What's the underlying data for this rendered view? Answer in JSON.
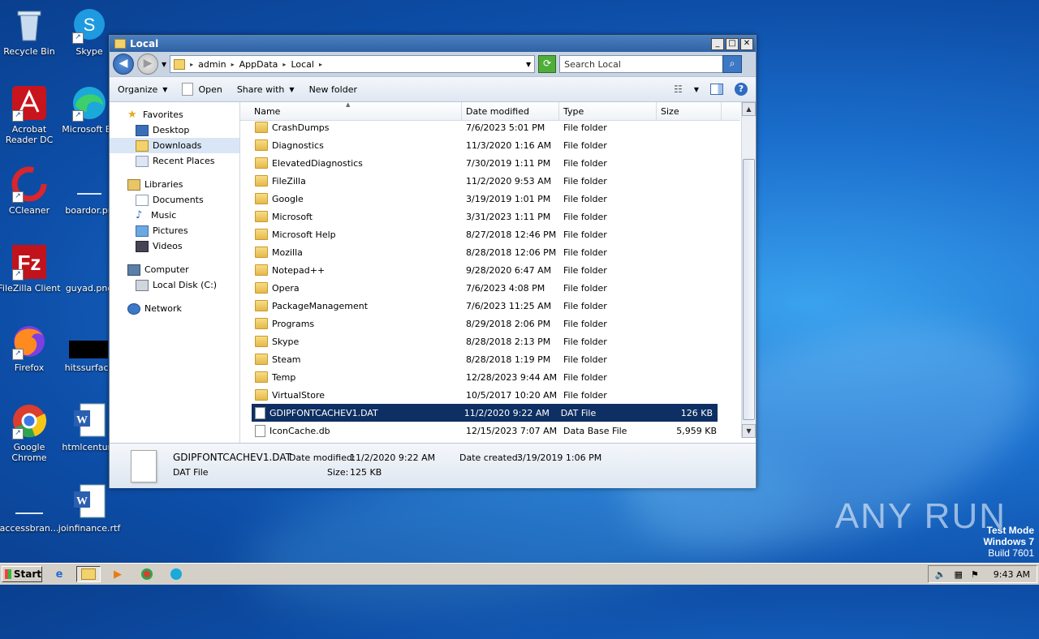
{
  "desktop": {
    "icons": [
      {
        "label": "Recycle Bin",
        "icon": "recycle-bin-icon"
      },
      {
        "label": "Skype",
        "icon": "skype-icon"
      },
      {
        "label": "Acrobat Reader DC",
        "icon": "acrobat-icon"
      },
      {
        "label": "Microsoft Ed",
        "icon": "edge-icon"
      },
      {
        "label": "CCleaner",
        "icon": "ccleaner-icon"
      },
      {
        "label": "boardor.pn",
        "icon": "image-file-icon"
      },
      {
        "label": "FileZilla Client",
        "icon": "filezilla-icon"
      },
      {
        "label": "guyad.png",
        "icon": "image-file-icon"
      },
      {
        "label": "Firefox",
        "icon": "firefox-icon"
      },
      {
        "label": "hitssurface",
        "icon": "image-file-icon"
      },
      {
        "label": "Google Chrome",
        "icon": "chrome-icon"
      },
      {
        "label": "htmlcentury",
        "icon": "word-doc-icon"
      },
      {
        "label": "accessbran...",
        "icon": "image-file-icon"
      },
      {
        "label": "joinfinance.rtf",
        "icon": "word-doc-icon"
      }
    ],
    "watermark": "ANY RUN",
    "test_mode": {
      "line1": "Test Mode",
      "line2": "Windows 7",
      "line3": "Build 7601"
    }
  },
  "window": {
    "title": "Local",
    "breadcrumb": [
      "admin",
      "AppData",
      "Local"
    ],
    "search_placeholder": "Search Local",
    "toolbar": {
      "organize": "Organize",
      "open": "Open",
      "share_with": "Share with",
      "new_folder": "New folder"
    },
    "nav": {
      "favorites": "Favorites",
      "fav_items": [
        "Desktop",
        "Downloads",
        "Recent Places"
      ],
      "libraries": "Libraries",
      "lib_items": [
        "Documents",
        "Music",
        "Pictures",
        "Videos"
      ],
      "computer": "Computer",
      "computer_items": [
        "Local Disk (C:)"
      ],
      "network": "Network"
    },
    "columns": {
      "name": "Name",
      "date": "Date modified",
      "type": "Type",
      "size": "Size"
    },
    "files": [
      {
        "name": "CrashDumps",
        "date": "7/6/2023 5:01 PM",
        "type": "File folder",
        "size": ""
      },
      {
        "name": "Diagnostics",
        "date": "11/3/2020 1:16 AM",
        "type": "File folder",
        "size": ""
      },
      {
        "name": "ElevatedDiagnostics",
        "date": "7/30/2019 1:11 PM",
        "type": "File folder",
        "size": ""
      },
      {
        "name": "FileZilla",
        "date": "11/2/2020 9:53 AM",
        "type": "File folder",
        "size": ""
      },
      {
        "name": "Google",
        "date": "3/19/2019 1:01 PM",
        "type": "File folder",
        "size": ""
      },
      {
        "name": "Microsoft",
        "date": "3/31/2023 1:11 PM",
        "type": "File folder",
        "size": ""
      },
      {
        "name": "Microsoft Help",
        "date": "8/27/2018 12:46 PM",
        "type": "File folder",
        "size": ""
      },
      {
        "name": "Mozilla",
        "date": "8/28/2018 12:06 PM",
        "type": "File folder",
        "size": ""
      },
      {
        "name": "Notepad++",
        "date": "9/28/2020 6:47 AM",
        "type": "File folder",
        "size": ""
      },
      {
        "name": "Opera",
        "date": "7/6/2023 4:08 PM",
        "type": "File folder",
        "size": ""
      },
      {
        "name": "PackageManagement",
        "date": "7/6/2023 11:25 AM",
        "type": "File folder",
        "size": ""
      },
      {
        "name": "Programs",
        "date": "8/29/2018 2:06 PM",
        "type": "File folder",
        "size": ""
      },
      {
        "name": "Skype",
        "date": "8/28/2018 2:13 PM",
        "type": "File folder",
        "size": ""
      },
      {
        "name": "Steam",
        "date": "8/28/2018 1:19 PM",
        "type": "File folder",
        "size": ""
      },
      {
        "name": "Temp",
        "date": "12/28/2023 9:44 AM",
        "type": "File folder",
        "size": ""
      },
      {
        "name": "VirtualStore",
        "date": "10/5/2017 10:20 AM",
        "type": "File folder",
        "size": ""
      },
      {
        "name": "GDIPFONTCACHEV1.DAT",
        "date": "11/2/2020 9:22 AM",
        "type": "DAT File",
        "size": "126 KB"
      },
      {
        "name": "IconCache.db",
        "date": "12/15/2023 7:07 AM",
        "type": "Data Base File",
        "size": "5,959 KB"
      }
    ],
    "details": {
      "filename": "GDIPFONTCACHEV1.DAT",
      "modified_label": "Date modified:",
      "modified": "11/2/2020 9:22 AM",
      "created_label": "Date created:",
      "created": "3/19/2019 1:06 PM",
      "type": "DAT File",
      "size_label": "Size:",
      "size": "125 KB"
    }
  },
  "taskbar": {
    "start": "Start",
    "clock": "9:43 AM"
  }
}
